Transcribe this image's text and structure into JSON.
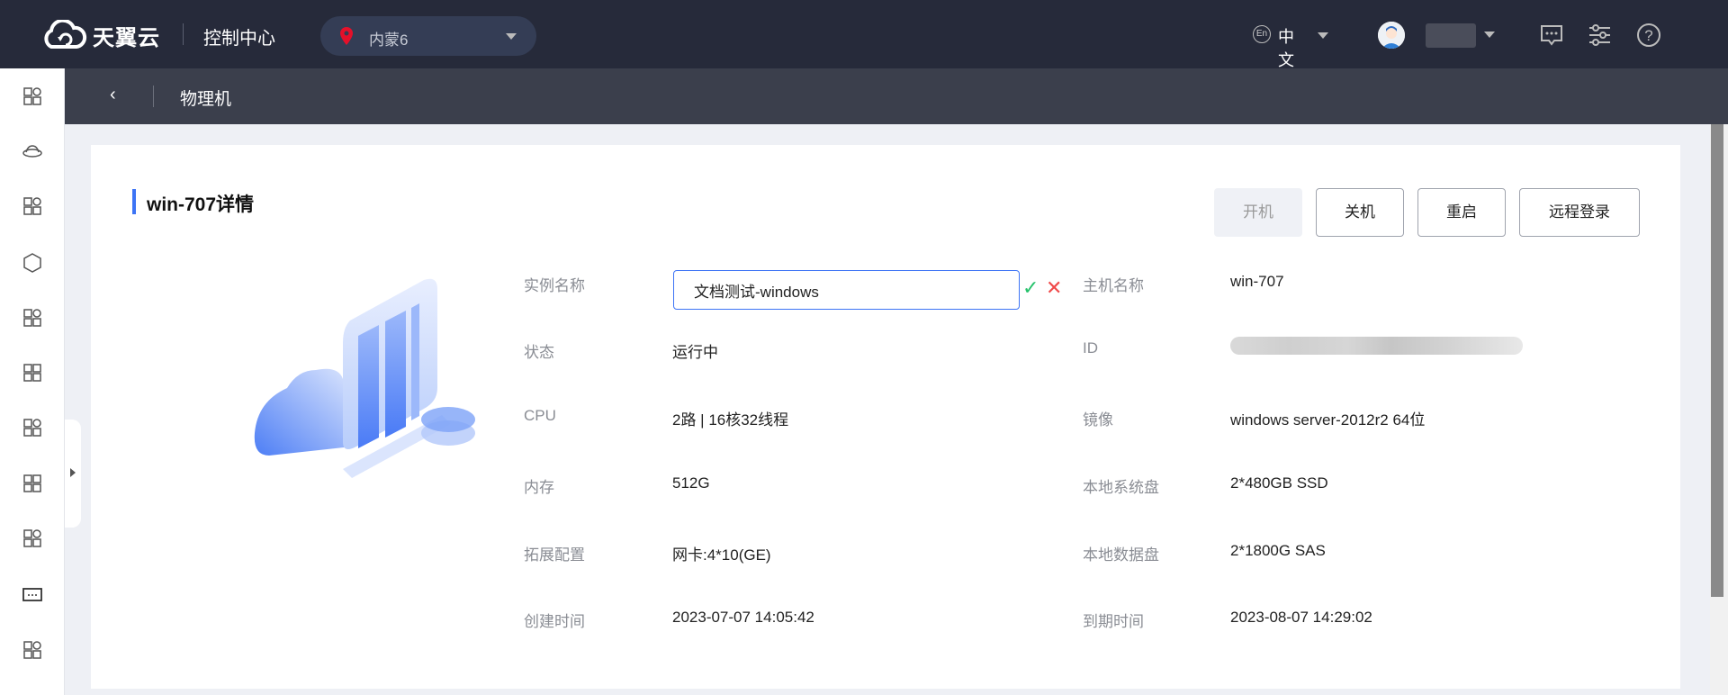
{
  "topbar": {
    "brand": "天翼云",
    "console": "控制中心",
    "region": "内蒙6",
    "language_badge": "En",
    "language": "中文",
    "icons": [
      "message-icon",
      "settings-sliders-icon",
      "help-icon"
    ]
  },
  "sidebar": {
    "icons": [
      "dashboard-icon",
      "cloud-storage-icon",
      "cloud-monitor-icon",
      "hexagon-layers-icon",
      "database-network-icon",
      "grid-apps-icon",
      "vpc-icon",
      "topology-icon",
      "chat-icon",
      "terminal-icon",
      "hexagon-cluster-icon"
    ]
  },
  "subbar": {
    "back": "‹",
    "title": "物理机"
  },
  "detail": {
    "title": "win-707详情",
    "buttons": {
      "start": "开机",
      "shutdown": "关机",
      "restart": "重启",
      "remote_login": "远程登录"
    },
    "left": [
      {
        "label": "实例名称",
        "value": "文档测试-windows"
      },
      {
        "label": "状态",
        "value": "运行中"
      },
      {
        "label": "CPU",
        "value": "2路 | 16核32线程"
      },
      {
        "label": "内存",
        "value": "512G"
      },
      {
        "label": "拓展配置",
        "value": "网卡:4*10(GE)"
      },
      {
        "label": "创建时间",
        "value": "2023-07-07 14:05:42"
      }
    ],
    "right": [
      {
        "label": "主机名称",
        "value": "win-707"
      },
      {
        "label": "ID",
        "value": ""
      },
      {
        "label": "镜像",
        "value": "windows server-2012r2 64位"
      },
      {
        "label": "本地系统盘",
        "value": "2*480GB SSD"
      },
      {
        "label": "本地数据盘",
        "value": "2*1800G SAS"
      },
      {
        "label": "到期时间",
        "value": "2023-08-07 14:29:02"
      }
    ],
    "confirm": "✓",
    "cancel": "✕"
  },
  "colors": {
    "accent": "#3d74f5",
    "topbar": "#262a3a",
    "subbar": "#3b3f4c",
    "ok": "#27c26c",
    "cancel": "#f04a4a"
  }
}
